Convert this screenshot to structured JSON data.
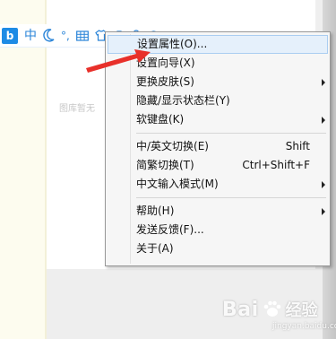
{
  "background": {
    "faint_text": "图库暂无"
  },
  "ime_toolbar": {
    "logo": "b",
    "mode_label": "中",
    "moon_icon": "moon-icon",
    "punct_label": "°,",
    "keyboard_icon": "keyboard-icon",
    "skin_icon": "shirt-icon",
    "toolbox_icon": "toolbox-icon",
    "user_icon": "user-icon",
    "menu_icon": "settings-icon"
  },
  "menu": {
    "items": [
      {
        "label": "设置属性(O)...",
        "shortcut": "",
        "submenu": false,
        "highlighted": true
      },
      {
        "label": "设置向导(X)",
        "shortcut": "",
        "submenu": false,
        "highlighted": false
      },
      {
        "label": "更换皮肤(S)",
        "shortcut": "",
        "submenu": true,
        "highlighted": false
      },
      {
        "label": "隐藏/显示状态栏(Y)",
        "shortcut": "",
        "submenu": false,
        "highlighted": false
      },
      {
        "label": "软键盘(K)",
        "shortcut": "",
        "submenu": true,
        "highlighted": false
      },
      {
        "label": "中/英文切换(E)",
        "shortcut": "Shift",
        "submenu": false,
        "highlighted": false
      },
      {
        "label": "简繁切换(T)",
        "shortcut": "Ctrl+Shift+F",
        "submenu": false,
        "highlighted": false
      },
      {
        "label": "中文输入模式(M)",
        "shortcut": "",
        "submenu": true,
        "highlighted": false
      },
      {
        "label": "帮助(H)",
        "shortcut": "",
        "submenu": true,
        "highlighted": false
      },
      {
        "label": "发送反馈(F)...",
        "shortcut": "",
        "submenu": false,
        "highlighted": false
      },
      {
        "label": "关于(A)",
        "shortcut": "",
        "submenu": false,
        "highlighted": false
      }
    ]
  },
  "watermark": {
    "brand": "Bai",
    "brand2": "经验",
    "url": "jingyan.baidu.com"
  },
  "colors": {
    "accent": "#2a84d8",
    "highlight_bg": "#e5f0fb",
    "highlight_border": "#aacdf1",
    "annotation": "#e8302a"
  }
}
